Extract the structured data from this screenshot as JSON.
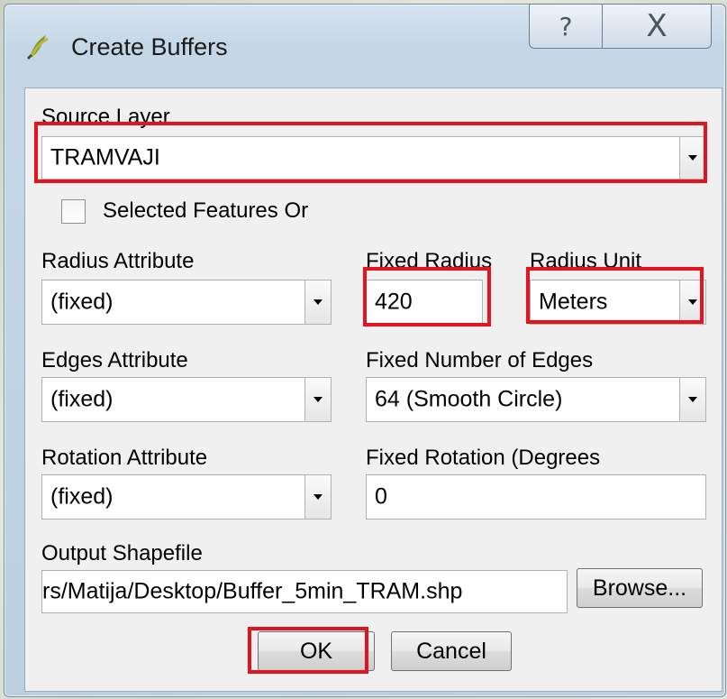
{
  "window": {
    "title": "Create Buffers",
    "help_glyph": "?",
    "close_glyph": "X"
  },
  "source_layer": {
    "label": "Source Layer",
    "value": "TRAMVAJI"
  },
  "selected_features": {
    "label": "Selected Features Or",
    "checked": false
  },
  "radius_attribute": {
    "label": "Radius Attribute",
    "value": "(fixed)"
  },
  "fixed_radius": {
    "label": "Fixed Radius",
    "value": "420"
  },
  "radius_unit": {
    "label": "Radius Unit",
    "value": "Meters"
  },
  "edges_attribute": {
    "label": "Edges Attribute",
    "value": "(fixed)"
  },
  "fixed_edges": {
    "label": "Fixed Number of Edges",
    "value": "64 (Smooth Circle)"
  },
  "rotation_attribute": {
    "label": "Rotation Attribute",
    "value": "(fixed)"
  },
  "fixed_rotation": {
    "label": "Fixed Rotation (Degrees",
    "value": "0"
  },
  "output_shapefile": {
    "label": "Output Shapefile",
    "value": "rs/Matija/Desktop/Buffer_5min_TRAM.shp",
    "browse_label": "Browse..."
  },
  "buttons": {
    "ok": "OK",
    "cancel": "Cancel"
  },
  "colors": {
    "highlight": "#e3141f"
  }
}
